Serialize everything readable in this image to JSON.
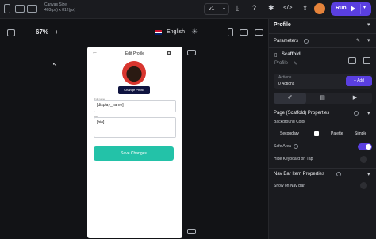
{
  "topbar": {
    "canvas_size_label": "Canvas Size",
    "canvas_size_value": "403(px) x 812(px)",
    "version": "v1",
    "run_label": "Run"
  },
  "canvas": {
    "zoom": "67%",
    "language": "English"
  },
  "phone": {
    "title": "Edit Profile",
    "change_photo": "Change Photo",
    "full_name_label": "Full name",
    "display_name": "[display_name]",
    "bio_label": "Bio",
    "bio": "[bio]",
    "save_label": "Save Changes"
  },
  "panel": {
    "title": "Profile",
    "parameters": "Parameters",
    "scaffold": "Scaffold",
    "widget_name": "Profile",
    "actions_label": "Actions",
    "actions_count": "0 Actions",
    "add_label": "+ Add",
    "page_props": "Page (Scaffold) Properties",
    "bg_color_label": "Background Color",
    "bg_secondary": "Secondary",
    "palette": "Palette",
    "simple": "Simple",
    "safe_area": "Safe Area",
    "hide_keyboard": "Hide Keyboard on Tap",
    "nav_bar_props": "Nav Bar Item Properties",
    "show_on_nav": "Show on Nav Bar"
  },
  "colors": {
    "accent": "#5a3fe0",
    "save_button": "#23c2a8"
  }
}
